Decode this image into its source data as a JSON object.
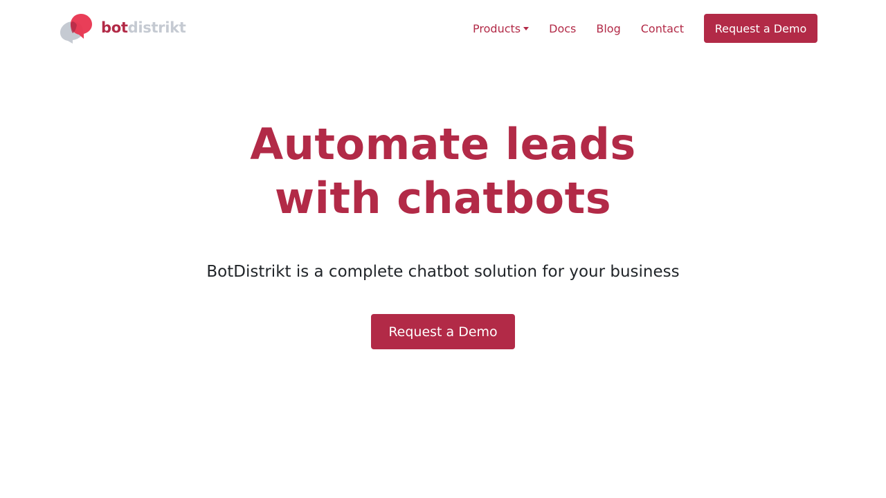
{
  "navbar": {
    "logo": {
      "text_bot": "bot",
      "text_distrikt": "distrikt",
      "icon": "speech-bubbles-logo-icon",
      "colors": {
        "primary": "#b22a47",
        "light": "#e8344f",
        "gray": "#c5cad2"
      }
    },
    "links": [
      {
        "label": "Products",
        "has_dropdown": true
      },
      {
        "label": "Docs"
      },
      {
        "label": "Blog"
      },
      {
        "label": "Contact"
      }
    ],
    "cta_label": "Request a Demo"
  },
  "hero": {
    "title_line1": "Automate leads",
    "title_line2": "with chatbots",
    "subtitle": "BotDistrikt is a complete chatbot solution for your business",
    "cta_label": "Request a Demo"
  },
  "theme": {
    "accent": "#b22a47",
    "text": "#212529",
    "background": "#ffffff"
  }
}
